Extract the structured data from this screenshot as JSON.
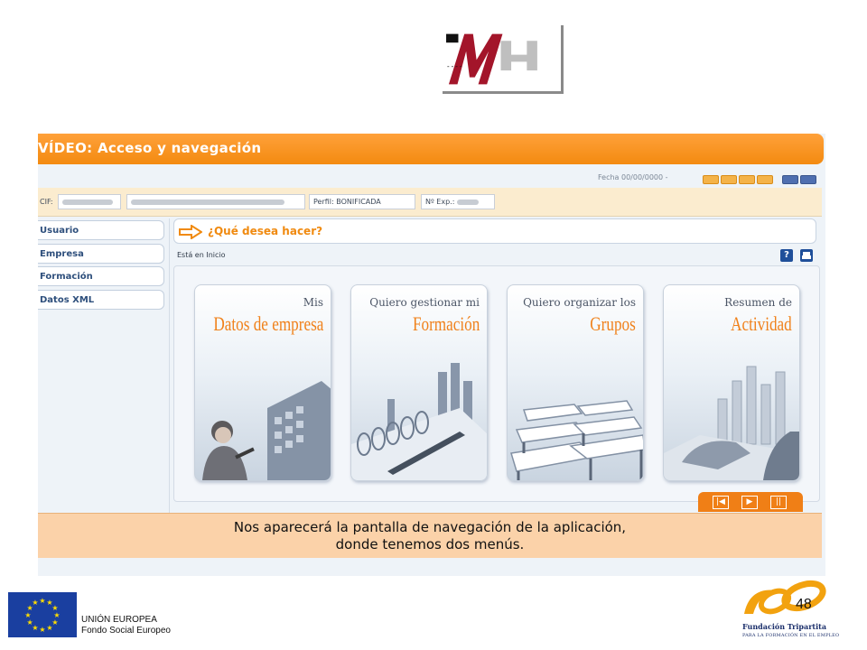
{
  "logo": {
    "text": "MH",
    "letters": "----"
  },
  "header": {
    "title": "VÍDEO: Acceso y navegación"
  },
  "toolbar": {
    "date_text": "Fecha 00/00/0000 -"
  },
  "info_bar": {
    "cif_label": "CIF:",
    "profile_label": "Perfil:",
    "profile_value": "BONIFICADA",
    "exp_label": "Nº Exp.:"
  },
  "sidebar": {
    "items": [
      {
        "label": "Usuario"
      },
      {
        "label": "Empresa"
      },
      {
        "label": "Formación"
      },
      {
        "label": "Datos XML"
      }
    ]
  },
  "main": {
    "question": "¿Qué desea hacer?",
    "breadcrumb": "Está en Inicio",
    "help_icon": "?",
    "cards": [
      {
        "line1": "Mis",
        "line2": "Datos de empresa",
        "image": "office-worker-building"
      },
      {
        "line1": "Quiero gestionar mi",
        "line2": "Formación",
        "image": "notebook-pen-chart"
      },
      {
        "line1": "Quiero organizar los",
        "line2": "Grupos",
        "image": "classroom-desks"
      },
      {
        "line1": "Resumen de",
        "line2": "Actividad",
        "image": "bar-chart-hand"
      }
    ]
  },
  "player_controls": {
    "buttons": [
      "rewind-icon",
      "play-icon",
      "pause-icon"
    ]
  },
  "caption": {
    "line1": "Nos aparecerá la pantalla de navegación de la aplicación,",
    "line2": "donde tenemos dos menús."
  },
  "footer": {
    "eu_line1": "UNIÓN EUROPEA",
    "eu_line2": "Fondo Social Europeo",
    "foundation_name": "Fundación Tripartita",
    "foundation_sub": "PARA LA FORMACIÓN EN EL EMPLEO",
    "page_number": "48"
  },
  "colors": {
    "accent_orange": "#f38a10",
    "caption_bg": "#fbd2a9",
    "nav_blue": "#2e4f7c",
    "eu_blue": "#1a3fa0",
    "eu_star": "#ffdd00",
    "logo_red": "#a3152a"
  }
}
